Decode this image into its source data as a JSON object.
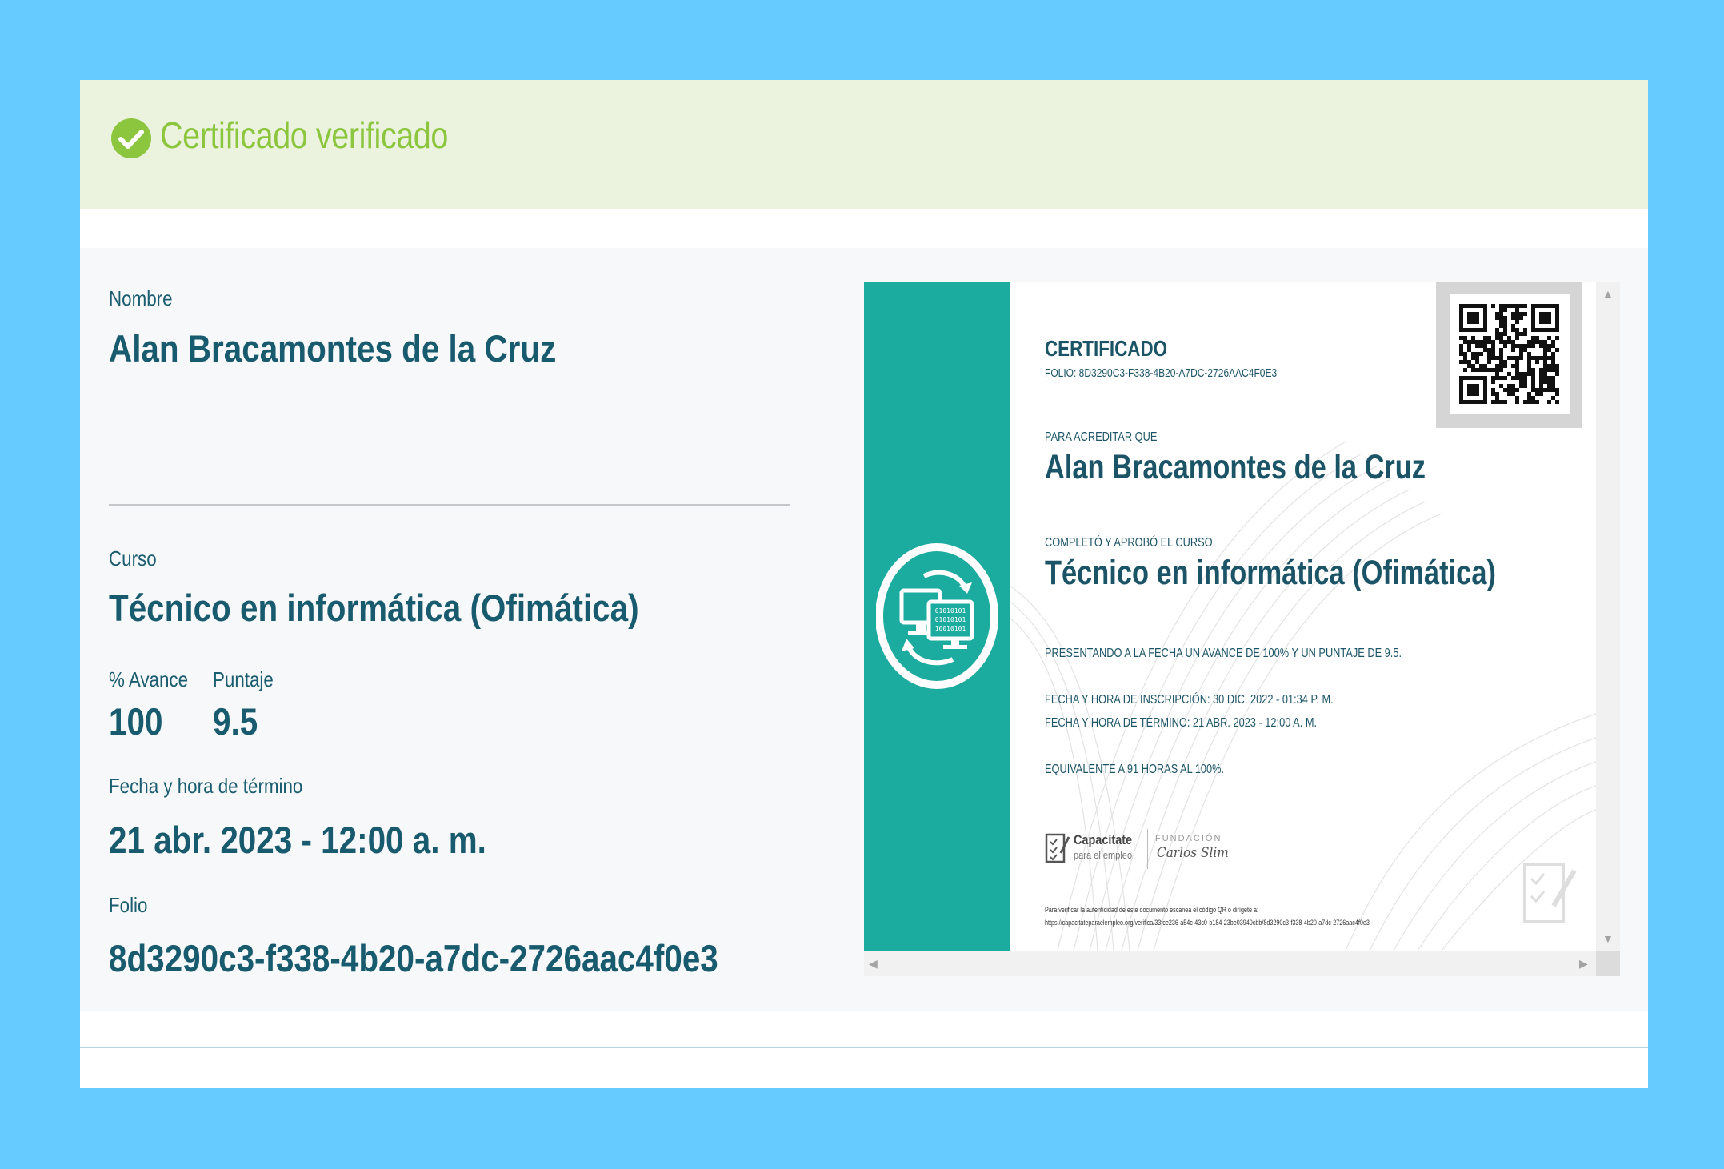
{
  "banner": {
    "title": "Certificado verificado"
  },
  "details": {
    "name_label": "Nombre",
    "name_value": "Alan Bracamontes de la Cruz",
    "course_label": "Curso",
    "course_value": "Técnico en informática (Ofimática)",
    "progress_label": "% Avance",
    "progress_value": "100",
    "score_label": "Puntaje",
    "score_value": "9.5",
    "end_label": "Fecha y hora de término",
    "end_value": "21 abr. 2023 - 12:00 a. m.",
    "folio_label": "Folio",
    "folio_value": "8d3290c3-f338-4b20-a7dc-2726aac4f0e3"
  },
  "certificate": {
    "heading": "CERTIFICADO",
    "folio_line": "FOLIO: 8D3290C3-F338-4B20-A7DC-2726AAC4F0E3",
    "accredit_label": "PARA ACREDITAR QUE",
    "name": "Alan Bracamontes de la Cruz",
    "completed_label": "COMPLETÓ Y APROBÓ EL CURSO",
    "course": "Técnico en informática (Ofimática)",
    "progress_line": "PRESENTANDO A LA FECHA UN AVANCE DE 100% Y UN PUNTAJE DE 9.5.",
    "enroll_line": "FECHA Y HORA DE INSCRIPCIÓN: 30 DIC. 2022 - 01:34 P. M.",
    "end_line": "FECHA Y HORA DE TÉRMINO: 21 ABR. 2023 - 12:00 A. M.",
    "hours_line": "EQUIVALENTE A 91 HORAS AL 100%.",
    "logo_capacitate": "Capacítate",
    "logo_capacitate_sub": "para el empleo",
    "logo_fundacion": "FUNDACIÓN",
    "logo_signature": "Carlos Slim",
    "verify_line1": "Para verificar la autenticidad de este documento escanea el código QR o dirígete a:",
    "verify_line2": "https://capacitateparaelempleo.org/verifica/33fce236-a54c-43c0-b184-23be03940cbb/8d3290c3-f338-4b20-a7dc-2726aac4f0e3",
    "emblem_binary": [
      "01010101",
      "01010101",
      "10010101"
    ]
  },
  "colors": {
    "accent_green": "#8cc63e",
    "text_teal": "#185a6e",
    "band_teal": "#1cab9f",
    "page_bg": "#66ccff"
  }
}
